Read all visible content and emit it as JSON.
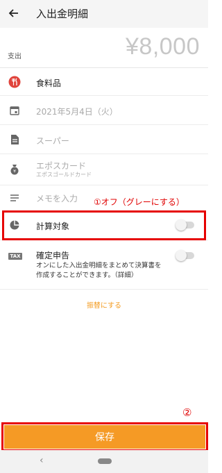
{
  "header": {
    "title": "入出金明細"
  },
  "amount": {
    "type_label": "支出",
    "value": "¥8,000"
  },
  "fields": {
    "category": "食料品",
    "date": "2021年5月4日（火）",
    "shop": "スーパー",
    "account": "エポスカード",
    "account_sub": "エポスゴールドカード",
    "memo_placeholder": "メモを入力"
  },
  "calc": {
    "label": "計算対象",
    "enabled": false
  },
  "tax": {
    "badge": "TAX",
    "label": "確定申告",
    "enabled": false,
    "desc_line1": "オンにした入出金明細をまとめて決算書を",
    "desc_line2": "作成することができます。（",
    "desc_link": "詳細",
    "desc_end": "）"
  },
  "transfer_link": "振替にする",
  "annotations": {
    "step1": "①オフ（グレーにする）",
    "step2": "②"
  },
  "save_button": "保存",
  "colors": {
    "accent": "#f59a25",
    "category_icon": "#e0443c",
    "annotation": "#e60000"
  }
}
